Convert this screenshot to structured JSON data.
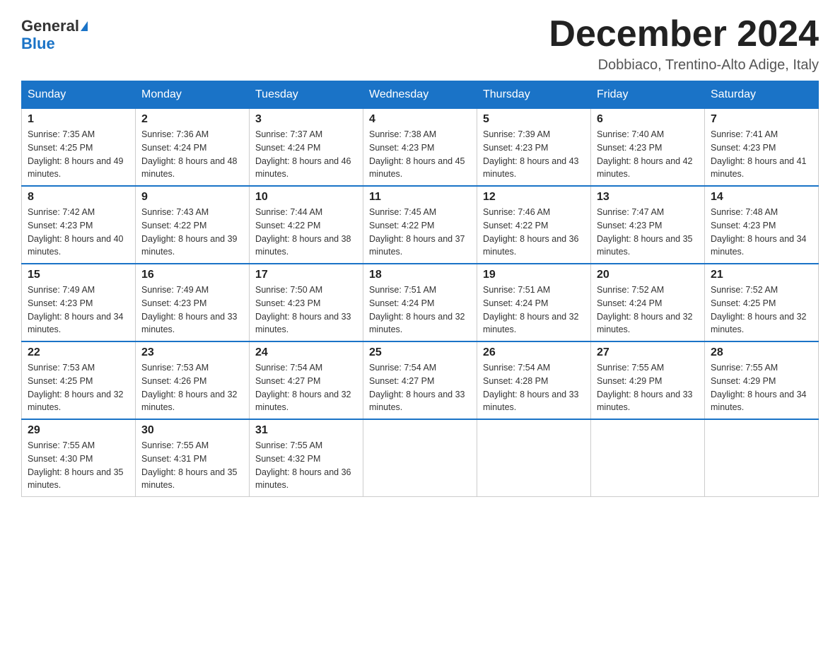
{
  "header": {
    "logo_line1": "General",
    "logo_line2": "Blue",
    "title": "December 2024",
    "location": "Dobbiaco, Trentino-Alto Adige, Italy"
  },
  "days_of_week": [
    "Sunday",
    "Monday",
    "Tuesday",
    "Wednesday",
    "Thursday",
    "Friday",
    "Saturday"
  ],
  "weeks": [
    {
      "days": [
        {
          "date": "1",
          "sunrise": "7:35 AM",
          "sunset": "4:25 PM",
          "daylight": "8 hours and 49 minutes."
        },
        {
          "date": "2",
          "sunrise": "7:36 AM",
          "sunset": "4:24 PM",
          "daylight": "8 hours and 48 minutes."
        },
        {
          "date": "3",
          "sunrise": "7:37 AM",
          "sunset": "4:24 PM",
          "daylight": "8 hours and 46 minutes."
        },
        {
          "date": "4",
          "sunrise": "7:38 AM",
          "sunset": "4:23 PM",
          "daylight": "8 hours and 45 minutes."
        },
        {
          "date": "5",
          "sunrise": "7:39 AM",
          "sunset": "4:23 PM",
          "daylight": "8 hours and 43 minutes."
        },
        {
          "date": "6",
          "sunrise": "7:40 AM",
          "sunset": "4:23 PM",
          "daylight": "8 hours and 42 minutes."
        },
        {
          "date": "7",
          "sunrise": "7:41 AM",
          "sunset": "4:23 PM",
          "daylight": "8 hours and 41 minutes."
        }
      ]
    },
    {
      "days": [
        {
          "date": "8",
          "sunrise": "7:42 AM",
          "sunset": "4:23 PM",
          "daylight": "8 hours and 40 minutes."
        },
        {
          "date": "9",
          "sunrise": "7:43 AM",
          "sunset": "4:22 PM",
          "daylight": "8 hours and 39 minutes."
        },
        {
          "date": "10",
          "sunrise": "7:44 AM",
          "sunset": "4:22 PM",
          "daylight": "8 hours and 38 minutes."
        },
        {
          "date": "11",
          "sunrise": "7:45 AM",
          "sunset": "4:22 PM",
          "daylight": "8 hours and 37 minutes."
        },
        {
          "date": "12",
          "sunrise": "7:46 AM",
          "sunset": "4:22 PM",
          "daylight": "8 hours and 36 minutes."
        },
        {
          "date": "13",
          "sunrise": "7:47 AM",
          "sunset": "4:23 PM",
          "daylight": "8 hours and 35 minutes."
        },
        {
          "date": "14",
          "sunrise": "7:48 AM",
          "sunset": "4:23 PM",
          "daylight": "8 hours and 34 minutes."
        }
      ]
    },
    {
      "days": [
        {
          "date": "15",
          "sunrise": "7:49 AM",
          "sunset": "4:23 PM",
          "daylight": "8 hours and 34 minutes."
        },
        {
          "date": "16",
          "sunrise": "7:49 AM",
          "sunset": "4:23 PM",
          "daylight": "8 hours and 33 minutes."
        },
        {
          "date": "17",
          "sunrise": "7:50 AM",
          "sunset": "4:23 PM",
          "daylight": "8 hours and 33 minutes."
        },
        {
          "date": "18",
          "sunrise": "7:51 AM",
          "sunset": "4:24 PM",
          "daylight": "8 hours and 32 minutes."
        },
        {
          "date": "19",
          "sunrise": "7:51 AM",
          "sunset": "4:24 PM",
          "daylight": "8 hours and 32 minutes."
        },
        {
          "date": "20",
          "sunrise": "7:52 AM",
          "sunset": "4:24 PM",
          "daylight": "8 hours and 32 minutes."
        },
        {
          "date": "21",
          "sunrise": "7:52 AM",
          "sunset": "4:25 PM",
          "daylight": "8 hours and 32 minutes."
        }
      ]
    },
    {
      "days": [
        {
          "date": "22",
          "sunrise": "7:53 AM",
          "sunset": "4:25 PM",
          "daylight": "8 hours and 32 minutes."
        },
        {
          "date": "23",
          "sunrise": "7:53 AM",
          "sunset": "4:26 PM",
          "daylight": "8 hours and 32 minutes."
        },
        {
          "date": "24",
          "sunrise": "7:54 AM",
          "sunset": "4:27 PM",
          "daylight": "8 hours and 32 minutes."
        },
        {
          "date": "25",
          "sunrise": "7:54 AM",
          "sunset": "4:27 PM",
          "daylight": "8 hours and 33 minutes."
        },
        {
          "date": "26",
          "sunrise": "7:54 AM",
          "sunset": "4:28 PM",
          "daylight": "8 hours and 33 minutes."
        },
        {
          "date": "27",
          "sunrise": "7:55 AM",
          "sunset": "4:29 PM",
          "daylight": "8 hours and 33 minutes."
        },
        {
          "date": "28",
          "sunrise": "7:55 AM",
          "sunset": "4:29 PM",
          "daylight": "8 hours and 34 minutes."
        }
      ]
    },
    {
      "days": [
        {
          "date": "29",
          "sunrise": "7:55 AM",
          "sunset": "4:30 PM",
          "daylight": "8 hours and 35 minutes."
        },
        {
          "date": "30",
          "sunrise": "7:55 AM",
          "sunset": "4:31 PM",
          "daylight": "8 hours and 35 minutes."
        },
        {
          "date": "31",
          "sunrise": "7:55 AM",
          "sunset": "4:32 PM",
          "daylight": "8 hours and 36 minutes."
        },
        null,
        null,
        null,
        null
      ]
    }
  ],
  "colors": {
    "header_bg": "#1a73c7",
    "header_text": "#ffffff",
    "border": "#cccccc",
    "day_number": "#222222",
    "body_text": "#333333"
  }
}
